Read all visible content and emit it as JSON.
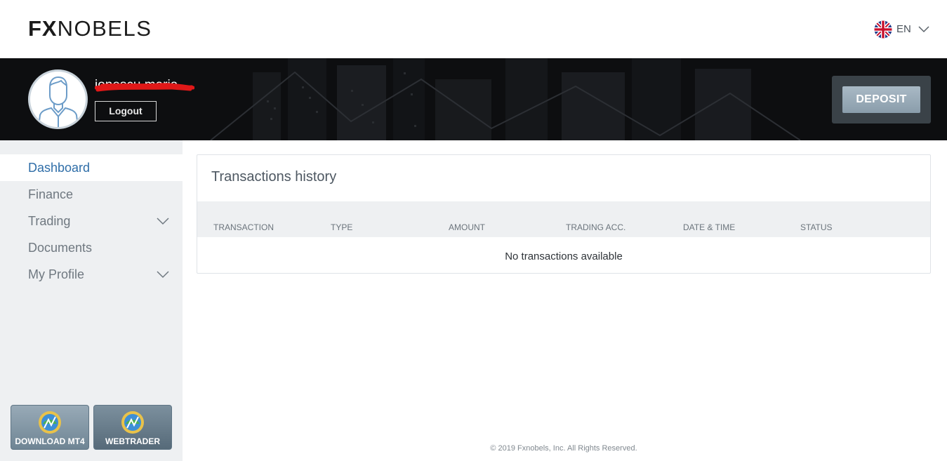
{
  "header": {
    "logo_bold": "FX",
    "logo_rest": "NOBELS",
    "language_code": "EN",
    "language_flag_icon": "uk-flag-icon"
  },
  "hero": {
    "username": "ionescu maria",
    "logout_label": "Logout",
    "deposit_label": "DEPOSIT"
  },
  "sidebar": {
    "items": [
      {
        "label": "Dashboard",
        "active": true,
        "has_submenu": false
      },
      {
        "label": "Finance",
        "active": false,
        "has_submenu": false
      },
      {
        "label": "Trading",
        "active": false,
        "has_submenu": true
      },
      {
        "label": "Documents",
        "active": false,
        "has_submenu": false
      },
      {
        "label": "My Profile",
        "active": false,
        "has_submenu": true
      }
    ],
    "download_mt4_label": "DOWNLOAD MT4",
    "webtrader_label": "WEBTRADER"
  },
  "transactions": {
    "title": "Transactions history",
    "columns": [
      "TRANSACTION",
      "TYPE",
      "AMOUNT",
      "TRADING ACC.",
      "DATE & TIME",
      "STATUS"
    ],
    "empty_message": "No transactions available"
  },
  "footer": {
    "copyright": "© 2019 Fxnobels, Inc. All Rights Reserved."
  },
  "colors": {
    "accent_blue": "#2f6ea8",
    "hero_bg": "#0e0f11",
    "sidebar_bg": "#eef0f2",
    "deposit_button": "#9aabb8"
  }
}
